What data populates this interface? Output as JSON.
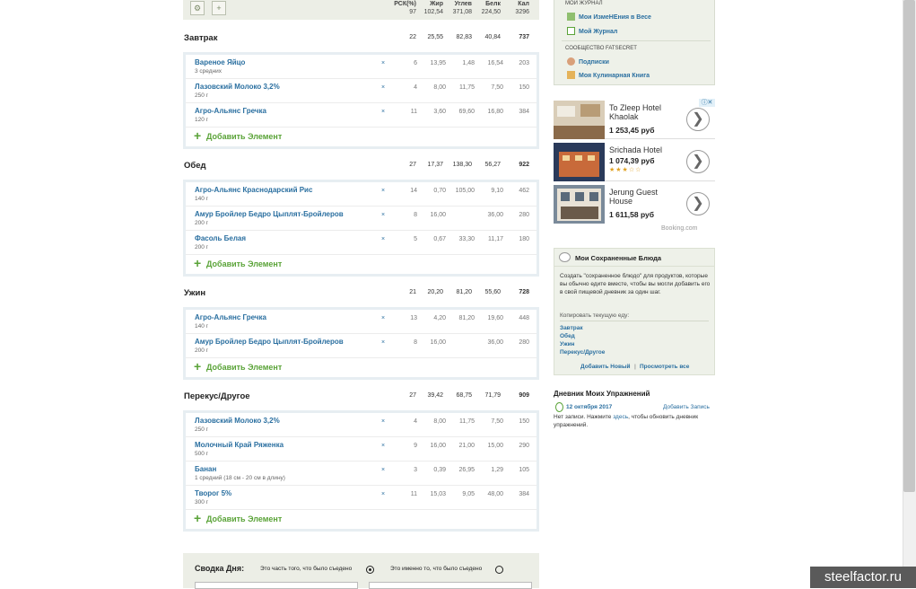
{
  "header": {
    "columns": [
      {
        "label": "РСК(%)",
        "total": "97"
      },
      {
        "label": "Жир",
        "total": "102,54"
      },
      {
        "label": "Углев",
        "total": "371,08"
      },
      {
        "label": "Белк",
        "total": "224,50"
      },
      {
        "label": "Кал",
        "total": "3296"
      }
    ]
  },
  "meals": [
    {
      "title": "Завтрак",
      "rsk": "22",
      "fat": "25,55",
      "carb": "82,83",
      "prot": "40,84",
      "cal": "737",
      "items": [
        {
          "name": "Вареное Яйцо",
          "portion": "3 средних",
          "rsk": "6",
          "fat": "13,95",
          "carb": "1,48",
          "prot": "16,54",
          "cal": "203"
        },
        {
          "name": "Лазовский Молоко 3,2%",
          "portion": "250 г",
          "rsk": "4",
          "fat": "8,00",
          "carb": "11,75",
          "prot": "7,50",
          "cal": "150"
        },
        {
          "name": "Агро-Альянс Гречка",
          "portion": "120 г",
          "rsk": "11",
          "fat": "3,60",
          "carb": "69,60",
          "prot": "16,80",
          "cal": "384"
        }
      ]
    },
    {
      "title": "Обед",
      "rsk": "27",
      "fat": "17,37",
      "carb": "138,30",
      "prot": "56,27",
      "cal": "922",
      "items": [
        {
          "name": "Агро-Альянс Краснодарский Рис",
          "portion": "140 г",
          "rsk": "14",
          "fat": "0,70",
          "carb": "105,00",
          "prot": "9,10",
          "cal": "462"
        },
        {
          "name": "Амур Бройлер Бедро Цыплят-Бройлеров",
          "portion": "200 г",
          "rsk": "8",
          "fat": "16,00",
          "carb": "",
          "prot": "36,00",
          "cal": "280"
        },
        {
          "name": "Фасоль Белая",
          "portion": "200 г",
          "rsk": "5",
          "fat": "0,67",
          "carb": "33,30",
          "prot": "11,17",
          "cal": "180"
        }
      ]
    },
    {
      "title": "Ужин",
      "rsk": "21",
      "fat": "20,20",
      "carb": "81,20",
      "prot": "55,60",
      "cal": "728",
      "items": [
        {
          "name": "Агро-Альянс Гречка",
          "portion": "140 г",
          "rsk": "13",
          "fat": "4,20",
          "carb": "81,20",
          "prot": "19,60",
          "cal": "448"
        },
        {
          "name": "Амур Бройлер Бедро Цыплят-Бройлеров",
          "portion": "200 г",
          "rsk": "8",
          "fat": "16,00",
          "carb": "",
          "prot": "36,00",
          "cal": "280"
        }
      ]
    },
    {
      "title": "Перекус/Другое",
      "rsk": "27",
      "fat": "39,42",
      "carb": "68,75",
      "prot": "71,79",
      "cal": "909",
      "items": [
        {
          "name": "Лазовский Молоко 3,2%",
          "portion": "250 г",
          "rsk": "4",
          "fat": "8,00",
          "carb": "11,75",
          "prot": "7,50",
          "cal": "150"
        },
        {
          "name": "Молочный Край Ряженка",
          "portion": "500 г",
          "rsk": "9",
          "fat": "16,00",
          "carb": "21,00",
          "prot": "15,00",
          "cal": "290"
        },
        {
          "name": "Банан",
          "portion": "1 средний (18 см - 20 см в длину)",
          "rsk": "3",
          "fat": "0,39",
          "carb": "26,95",
          "prot": "1,29",
          "cal": "105"
        },
        {
          "name": "Творог 5%",
          "portion": "300 г",
          "rsk": "11",
          "fat": "15,03",
          "carb": "9,05",
          "prot": "48,00",
          "cal": "384"
        }
      ]
    }
  ],
  "remove_glyph": "×",
  "add_item_label": "Добавить Элемент",
  "add_plus": "+",
  "summary": {
    "title": "Сводка Дня:",
    "option1": "Это часть того, что было съедено",
    "option2": "Это именно то, что было съедено"
  },
  "journal": {
    "section1": "Мои журнал",
    "link_changes": "Мои ИзмеНЕния в Весе",
    "link_journal": "Мой Журнал",
    "section2": "Сообщество FatSecret",
    "link_subs": "Подписки",
    "link_book": "Моя Кулинарная Книга"
  },
  "ads": {
    "badge": "ⓘ✕",
    "source": "Booking.com",
    "items": [
      {
        "title": "To Zleep Hotel Khaolak",
        "price": "1 253,45 руб"
      },
      {
        "title": "Srichada Hotel",
        "price": "1 074,39 руб",
        "stars": "★★★☆☆"
      },
      {
        "title": "Jerung Guest House",
        "price": "1 611,58 руб"
      }
    ],
    "arrow": "❯"
  },
  "saved": {
    "title": "Мои Сохраненные Блюда",
    "description": "Создать \"сохраненное блюдо\" для продуктов, которые вы обычно едите вместе, чтобы вы могли добавить его в свой пищевой дневник за один шаг.",
    "copy_label": "Копировать текущую еду:",
    "meals": [
      "Завтрак",
      "Обед",
      "Ужин",
      "Перекус/Другое"
    ],
    "add_new": "Добавить Новый",
    "sep": "|",
    "view_all": "Просмотреть все"
  },
  "exercise": {
    "title": "Дневник Моих Упражнений",
    "date": "12 октября 2017",
    "add": "Добавить Запись",
    "note_pre": "Нет записи. Нажмите ",
    "note_link": "здесь",
    "note_post": ", чтобы обновить дневник упражнений."
  },
  "watermark": "steelfactor.ru",
  "colors": {
    "link": "#2a6fa0",
    "add_green": "#5aa338",
    "panel_bg": "#eef1e9"
  }
}
